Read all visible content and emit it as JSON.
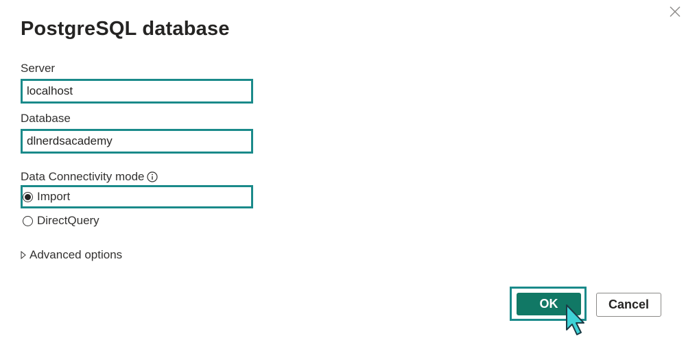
{
  "dialog": {
    "title": "PostgreSQL database",
    "close_icon": "close-icon"
  },
  "server": {
    "label": "Server",
    "value": "localhost"
  },
  "database": {
    "label": "Database",
    "value": "dlnerdsacademy"
  },
  "connectivity": {
    "label": "Data Connectivity mode",
    "info_icon": "info-icon",
    "options": [
      {
        "label": "Import",
        "selected": true
      },
      {
        "label": "DirectQuery",
        "selected": false
      }
    ]
  },
  "advanced": {
    "label": "Advanced options",
    "expand_icon": "triangle-right-icon"
  },
  "buttons": {
    "ok_label": "OK",
    "cancel_label": "Cancel"
  },
  "colors": {
    "accent_outline": "#1a8a8a",
    "primary_button": "#117865",
    "cursor_fill": "#3fd2d7"
  }
}
